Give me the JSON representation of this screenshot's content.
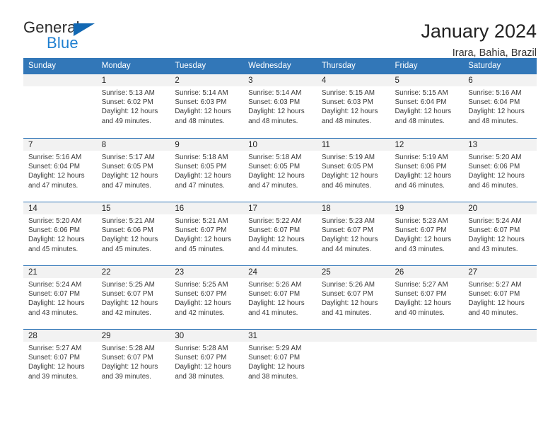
{
  "brand": {
    "name_top": "General",
    "name_bottom": "Blue",
    "triangle_icon": "triangle-icon",
    "accent_color": "#1268b3"
  },
  "header": {
    "title": "January 2024",
    "subtitle": "Irara, Bahia, Brazil"
  },
  "theme": {
    "header_blue": "#3277b8",
    "daynum_band": "#f2f2f2",
    "text": "#222222"
  },
  "weekday_headers": [
    "Sunday",
    "Monday",
    "Tuesday",
    "Wednesday",
    "Thursday",
    "Friday",
    "Saturday"
  ],
  "weeks": [
    [
      {
        "day": "",
        "sunrise": "",
        "sunset": "",
        "daylight_line1": "",
        "daylight_line2": ""
      },
      {
        "day": "1",
        "sunrise": "Sunrise: 5:13 AM",
        "sunset": "Sunset: 6:02 PM",
        "daylight_line1": "Daylight: 12 hours",
        "daylight_line2": "and 49 minutes."
      },
      {
        "day": "2",
        "sunrise": "Sunrise: 5:14 AM",
        "sunset": "Sunset: 6:03 PM",
        "daylight_line1": "Daylight: 12 hours",
        "daylight_line2": "and 48 minutes."
      },
      {
        "day": "3",
        "sunrise": "Sunrise: 5:14 AM",
        "sunset": "Sunset: 6:03 PM",
        "daylight_line1": "Daylight: 12 hours",
        "daylight_line2": "and 48 minutes."
      },
      {
        "day": "4",
        "sunrise": "Sunrise: 5:15 AM",
        "sunset": "Sunset: 6:03 PM",
        "daylight_line1": "Daylight: 12 hours",
        "daylight_line2": "and 48 minutes."
      },
      {
        "day": "5",
        "sunrise": "Sunrise: 5:15 AM",
        "sunset": "Sunset: 6:04 PM",
        "daylight_line1": "Daylight: 12 hours",
        "daylight_line2": "and 48 minutes."
      },
      {
        "day": "6",
        "sunrise": "Sunrise: 5:16 AM",
        "sunset": "Sunset: 6:04 PM",
        "daylight_line1": "Daylight: 12 hours",
        "daylight_line2": "and 48 minutes."
      }
    ],
    [
      {
        "day": "7",
        "sunrise": "Sunrise: 5:16 AM",
        "sunset": "Sunset: 6:04 PM",
        "daylight_line1": "Daylight: 12 hours",
        "daylight_line2": "and 47 minutes."
      },
      {
        "day": "8",
        "sunrise": "Sunrise: 5:17 AM",
        "sunset": "Sunset: 6:05 PM",
        "daylight_line1": "Daylight: 12 hours",
        "daylight_line2": "and 47 minutes."
      },
      {
        "day": "9",
        "sunrise": "Sunrise: 5:18 AM",
        "sunset": "Sunset: 6:05 PM",
        "daylight_line1": "Daylight: 12 hours",
        "daylight_line2": "and 47 minutes."
      },
      {
        "day": "10",
        "sunrise": "Sunrise: 5:18 AM",
        "sunset": "Sunset: 6:05 PM",
        "daylight_line1": "Daylight: 12 hours",
        "daylight_line2": "and 47 minutes."
      },
      {
        "day": "11",
        "sunrise": "Sunrise: 5:19 AM",
        "sunset": "Sunset: 6:05 PM",
        "daylight_line1": "Daylight: 12 hours",
        "daylight_line2": "and 46 minutes."
      },
      {
        "day": "12",
        "sunrise": "Sunrise: 5:19 AM",
        "sunset": "Sunset: 6:06 PM",
        "daylight_line1": "Daylight: 12 hours",
        "daylight_line2": "and 46 minutes."
      },
      {
        "day": "13",
        "sunrise": "Sunrise: 5:20 AM",
        "sunset": "Sunset: 6:06 PM",
        "daylight_line1": "Daylight: 12 hours",
        "daylight_line2": "and 46 minutes."
      }
    ],
    [
      {
        "day": "14",
        "sunrise": "Sunrise: 5:20 AM",
        "sunset": "Sunset: 6:06 PM",
        "daylight_line1": "Daylight: 12 hours",
        "daylight_line2": "and 45 minutes."
      },
      {
        "day": "15",
        "sunrise": "Sunrise: 5:21 AM",
        "sunset": "Sunset: 6:06 PM",
        "daylight_line1": "Daylight: 12 hours",
        "daylight_line2": "and 45 minutes."
      },
      {
        "day": "16",
        "sunrise": "Sunrise: 5:21 AM",
        "sunset": "Sunset: 6:07 PM",
        "daylight_line1": "Daylight: 12 hours",
        "daylight_line2": "and 45 minutes."
      },
      {
        "day": "17",
        "sunrise": "Sunrise: 5:22 AM",
        "sunset": "Sunset: 6:07 PM",
        "daylight_line1": "Daylight: 12 hours",
        "daylight_line2": "and 44 minutes."
      },
      {
        "day": "18",
        "sunrise": "Sunrise: 5:23 AM",
        "sunset": "Sunset: 6:07 PM",
        "daylight_line1": "Daylight: 12 hours",
        "daylight_line2": "and 44 minutes."
      },
      {
        "day": "19",
        "sunrise": "Sunrise: 5:23 AM",
        "sunset": "Sunset: 6:07 PM",
        "daylight_line1": "Daylight: 12 hours",
        "daylight_line2": "and 43 minutes."
      },
      {
        "day": "20",
        "sunrise": "Sunrise: 5:24 AM",
        "sunset": "Sunset: 6:07 PM",
        "daylight_line1": "Daylight: 12 hours",
        "daylight_line2": "and 43 minutes."
      }
    ],
    [
      {
        "day": "21",
        "sunrise": "Sunrise: 5:24 AM",
        "sunset": "Sunset: 6:07 PM",
        "daylight_line1": "Daylight: 12 hours",
        "daylight_line2": "and 43 minutes."
      },
      {
        "day": "22",
        "sunrise": "Sunrise: 5:25 AM",
        "sunset": "Sunset: 6:07 PM",
        "daylight_line1": "Daylight: 12 hours",
        "daylight_line2": "and 42 minutes."
      },
      {
        "day": "23",
        "sunrise": "Sunrise: 5:25 AM",
        "sunset": "Sunset: 6:07 PM",
        "daylight_line1": "Daylight: 12 hours",
        "daylight_line2": "and 42 minutes."
      },
      {
        "day": "24",
        "sunrise": "Sunrise: 5:26 AM",
        "sunset": "Sunset: 6:07 PM",
        "daylight_line1": "Daylight: 12 hours",
        "daylight_line2": "and 41 minutes."
      },
      {
        "day": "25",
        "sunrise": "Sunrise: 5:26 AM",
        "sunset": "Sunset: 6:07 PM",
        "daylight_line1": "Daylight: 12 hours",
        "daylight_line2": "and 41 minutes."
      },
      {
        "day": "26",
        "sunrise": "Sunrise: 5:27 AM",
        "sunset": "Sunset: 6:07 PM",
        "daylight_line1": "Daylight: 12 hours",
        "daylight_line2": "and 40 minutes."
      },
      {
        "day": "27",
        "sunrise": "Sunrise: 5:27 AM",
        "sunset": "Sunset: 6:07 PM",
        "daylight_line1": "Daylight: 12 hours",
        "daylight_line2": "and 40 minutes."
      }
    ],
    [
      {
        "day": "28",
        "sunrise": "Sunrise: 5:27 AM",
        "sunset": "Sunset: 6:07 PM",
        "daylight_line1": "Daylight: 12 hours",
        "daylight_line2": "and 39 minutes."
      },
      {
        "day": "29",
        "sunrise": "Sunrise: 5:28 AM",
        "sunset": "Sunset: 6:07 PM",
        "daylight_line1": "Daylight: 12 hours",
        "daylight_line2": "and 39 minutes."
      },
      {
        "day": "30",
        "sunrise": "Sunrise: 5:28 AM",
        "sunset": "Sunset: 6:07 PM",
        "daylight_line1": "Daylight: 12 hours",
        "daylight_line2": "and 38 minutes."
      },
      {
        "day": "31",
        "sunrise": "Sunrise: 5:29 AM",
        "sunset": "Sunset: 6:07 PM",
        "daylight_line1": "Daylight: 12 hours",
        "daylight_line2": "and 38 minutes."
      },
      {
        "day": "",
        "sunrise": "",
        "sunset": "",
        "daylight_line1": "",
        "daylight_line2": ""
      },
      {
        "day": "",
        "sunrise": "",
        "sunset": "",
        "daylight_line1": "",
        "daylight_line2": ""
      },
      {
        "day": "",
        "sunrise": "",
        "sunset": "",
        "daylight_line1": "",
        "daylight_line2": ""
      }
    ]
  ]
}
